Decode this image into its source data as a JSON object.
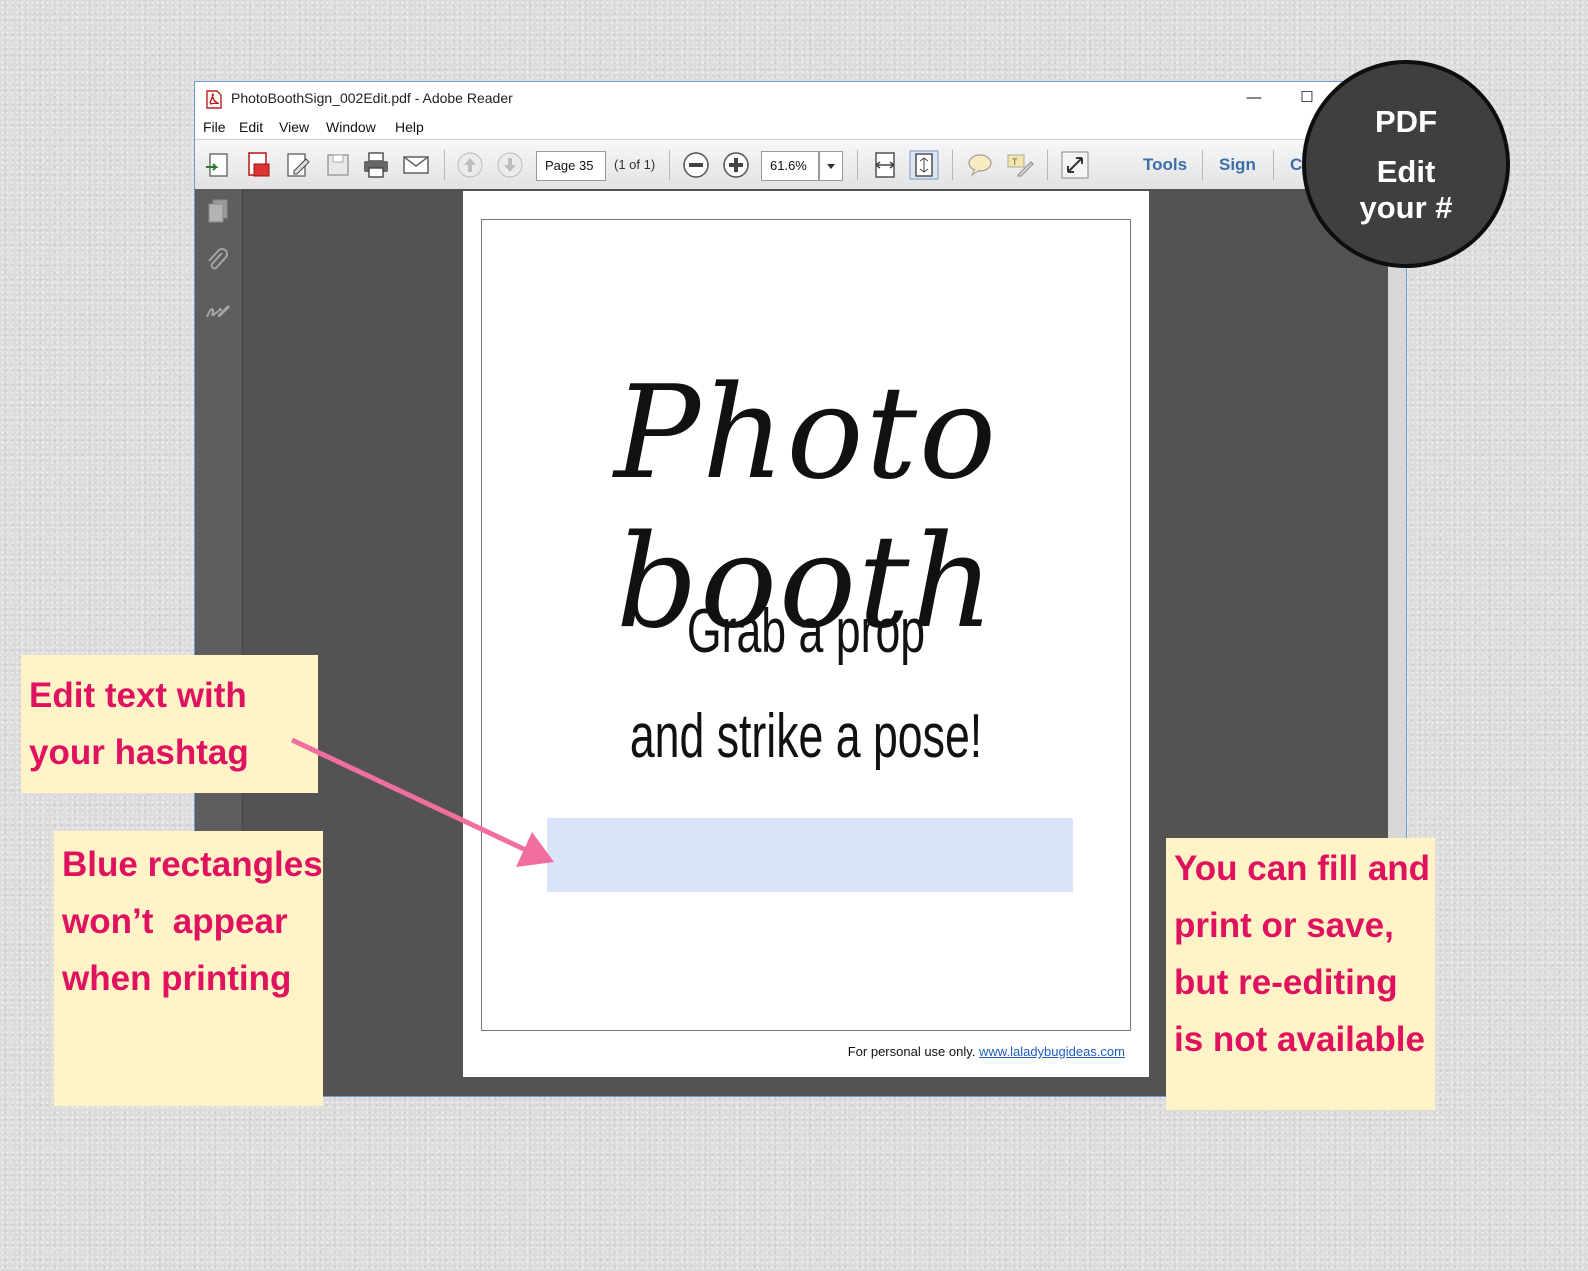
{
  "window": {
    "title": "PhotoBoothSign_002Edit.pdf - Adobe Reader",
    "minimize_glyph": "—",
    "maximize_glyph": "☐"
  },
  "menu": [
    "File",
    "Edit",
    "View",
    "Window",
    "Help"
  ],
  "toolbar": {
    "page_field": "Page 35",
    "page_count": "(1 of 1)",
    "zoom_value": "61.6%",
    "tools_label": "Tools",
    "sign_label": "Sign",
    "comment_label_partial": "C"
  },
  "icons": {
    "title": "pdf-file-icon",
    "toolbar": [
      "create-pdf-icon",
      "open-icon",
      "edit-icon",
      "save-icon",
      "print-icon",
      "email-icon",
      "prev-page-icon",
      "next-page-icon",
      "zoom-out-icon",
      "zoom-in-icon",
      "fit-width-icon",
      "fit-page-icon",
      "comment-icon",
      "highlight-icon",
      "fullscreen-icon"
    ],
    "leftpane": [
      "pages-icon",
      "attachments-icon",
      "signatures-icon"
    ]
  },
  "document": {
    "headline": "Photo booth",
    "subline1": "Grab a prop",
    "subline2": "and strike a pose!",
    "footer_text": "For personal use only.",
    "footer_link": "www.laladybugideas.com"
  },
  "badge": {
    "line1": "PDF",
    "line2": "Edit",
    "line3": "your #"
  },
  "notes": {
    "note1": [
      "Edit text with",
      "your hashtag"
    ],
    "note2": [
      "Blue rectangles",
      "won’t  appear",
      "when printing"
    ],
    "note3": [
      "You can fill and",
      "print or save,",
      "but re-editing",
      "is not available"
    ]
  },
  "colors": {
    "note_background": "#fff3c7",
    "note_text": "#e0125f",
    "arrow": "#f06ea0",
    "field_highlight": "#dbe3fa",
    "badge_background": "#3f3f3f",
    "doc_background": "#535353"
  }
}
